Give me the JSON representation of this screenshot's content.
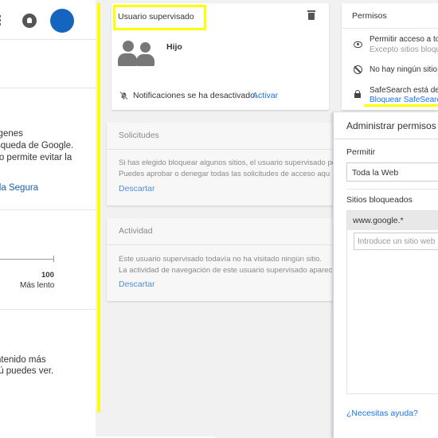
{
  "left_panel": {
    "text_lines": [
      "igenes",
      "squeda de Google.",
      "ro permite evitar la"
    ],
    "safe_link": "da Segura",
    "slider": {
      "value_label": "100",
      "caption": "Más lento"
    },
    "content_lines": [
      "ntenido más",
      "tú puedes ver."
    ]
  },
  "profile_card": {
    "title": "Usuario supervisado",
    "name": "Hijo",
    "notification_text": "Notificaciones se ha desactivado.",
    "activate_label": "Activar"
  },
  "requests_card": {
    "title": "Solicitudes",
    "lines": [
      "Si has elegido bloquear algunos sitios, el usuario supervisado po",
      "Puedes aprobar o denegar todas las solicitudes de acceso aqu"
    ],
    "dismiss_label": "Descartar"
  },
  "activity_card": {
    "title": "Actividad",
    "lines": [
      "Este usuario supervisado todavía no ha visitado ningún sitio.",
      "La actividad de navegación de este usuario supervisado aparec"
    ],
    "dismiss_label": "Descartar"
  },
  "permissions_card": {
    "title": "Permisos",
    "items": [
      {
        "icon": "eye-icon",
        "primary": "Permitir acceso a to",
        "secondary": "Excepto sitios bloqu"
      },
      {
        "icon": "no-entry-icon",
        "primary": "No hay ningún sitio b",
        "secondary": ""
      },
      {
        "icon": "lock-icon",
        "primary": "SafeSearch está des",
        "secondary": "Bloquear SafeSearch"
      }
    ]
  },
  "dialog": {
    "title": "Administrar permisos",
    "allow_label": "Permitir",
    "allow_value": "Toda la Web",
    "blocked_label": "Sitios bloqueados",
    "blocked_sites": [
      "www.google.*"
    ],
    "input_placeholder": "Introduce un sitio web",
    "help_link": "¿Necesitas ayuda?"
  },
  "colors": {
    "highlight": "#ffff00",
    "link": "#1a73e8",
    "avatar": "#1565c0"
  }
}
